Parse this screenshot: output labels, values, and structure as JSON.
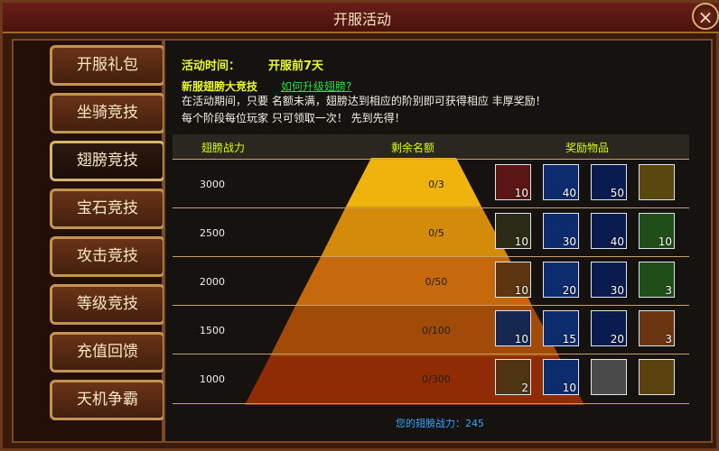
{
  "window": {
    "title": "开服活动"
  },
  "tabs": [
    "开服礼包",
    "坐骑竞技",
    "翅膀竞技",
    "宝石竞技",
    "攻击竞技",
    "等级竞技",
    "充值回馈",
    "天机争霸"
  ],
  "active_tab_index": 2,
  "content": {
    "activity_time_label": "活动时间：",
    "activity_time_value": "开服前7天",
    "event_title": "新服翅膀大竞技",
    "upgrade_link": "如何升级翅膀?",
    "desc1": "在活动期间，只要 名额未满，翅膀达到相应的阶别即可获得相应 丰厚奖励！",
    "desc2": "每个阶段每位玩家 只可领取一次！ 先到先得！",
    "columns": {
      "power": "翅膀战力",
      "remaining": "剩余名额",
      "rewards": "奖励物品"
    },
    "footer": "您的翅膀战力：245"
  },
  "rows": [
    {
      "power": "3000",
      "remain": "0/3",
      "items": [
        {
          "icon": "red-gem-icon",
          "qty": "10"
        },
        {
          "icon": "blue-comet-icon",
          "qty": "40"
        },
        {
          "icon": "blue-orb-icon",
          "qty": "50"
        },
        {
          "icon": "gold-ring-icon",
          "qty": ""
        }
      ]
    },
    {
      "power": "2500",
      "remain": "0/5",
      "items": [
        {
          "icon": "green-pink-gem-icon",
          "qty": "10"
        },
        {
          "icon": "blue-comet-icon",
          "qty": "30"
        },
        {
          "icon": "blue-orb-icon",
          "qty": "40"
        },
        {
          "icon": "green-orb-icon",
          "qty": "10"
        }
      ]
    },
    {
      "power": "2000",
      "remain": "0/50",
      "items": [
        {
          "icon": "gold-flower-icon",
          "qty": "10"
        },
        {
          "icon": "blue-comet-icon",
          "qty": "20"
        },
        {
          "icon": "blue-orb-icon",
          "qty": "30"
        },
        {
          "icon": "green-orb-icon",
          "qty": "3"
        }
      ]
    },
    {
      "power": "1500",
      "remain": "0/100",
      "items": [
        {
          "icon": "blue-feather-icon",
          "qty": "10"
        },
        {
          "icon": "blue-comet-icon",
          "qty": "15"
        },
        {
          "icon": "blue-orb-icon",
          "qty": "20"
        },
        {
          "icon": "orange-orb-icon",
          "qty": "3"
        }
      ]
    },
    {
      "power": "1000",
      "remain": "0/300",
      "items": [
        {
          "icon": "golden-spear-icon",
          "qty": "2"
        },
        {
          "icon": "blue-comet-icon",
          "qty": "10"
        },
        {
          "icon": "silver-bars-icon",
          "qty": ""
        },
        {
          "icon": "gold-ingot-icon",
          "qty": ""
        }
      ]
    }
  ]
}
